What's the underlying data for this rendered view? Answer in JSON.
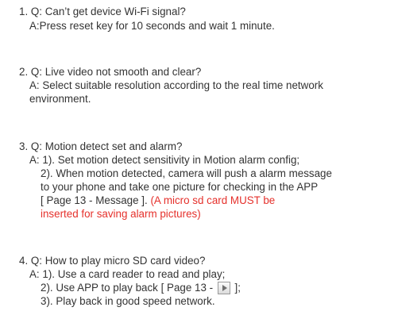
{
  "faq": [
    {
      "question": "1. Q: Can’t get device Wi-Fi signal?",
      "answer": "A:Press reset key for 10 seconds and wait 1 minute."
    },
    {
      "question": "2. Q: Live video not smooth and clear?",
      "answer_line1": "A: Select suitable resolution according to the real time network",
      "answer_line2": "environment."
    },
    {
      "question": "3. Q: Motion detect set and alarm?",
      "answer_line1": "A: 1). Set motion detect sensitivity in Motion alarm config;",
      "answer_line2": "2). When motion detected, camera will push a alarm message",
      "answer_line3": "to your phone and take one picture for checking in the APP",
      "answer_line4_black": "[ Page 13 - Message ]. ",
      "answer_line4_red": "(A micro sd card MUST be",
      "answer_line5_red": "inserted for saving alarm pictures)"
    },
    {
      "question": "4. Q: How to play micro SD card video?",
      "answer_line1": "A: 1). Use a card reader to read and play;",
      "answer_line2_before": "2). Use APP to play back [ Page 13 - ",
      "answer_line2_after": " ];",
      "answer_line3": "3). Play back in good speed network."
    }
  ],
  "icons": {
    "playback": "play-button-icon"
  },
  "colors": {
    "text": "#333333",
    "warning": "#e5302b"
  }
}
